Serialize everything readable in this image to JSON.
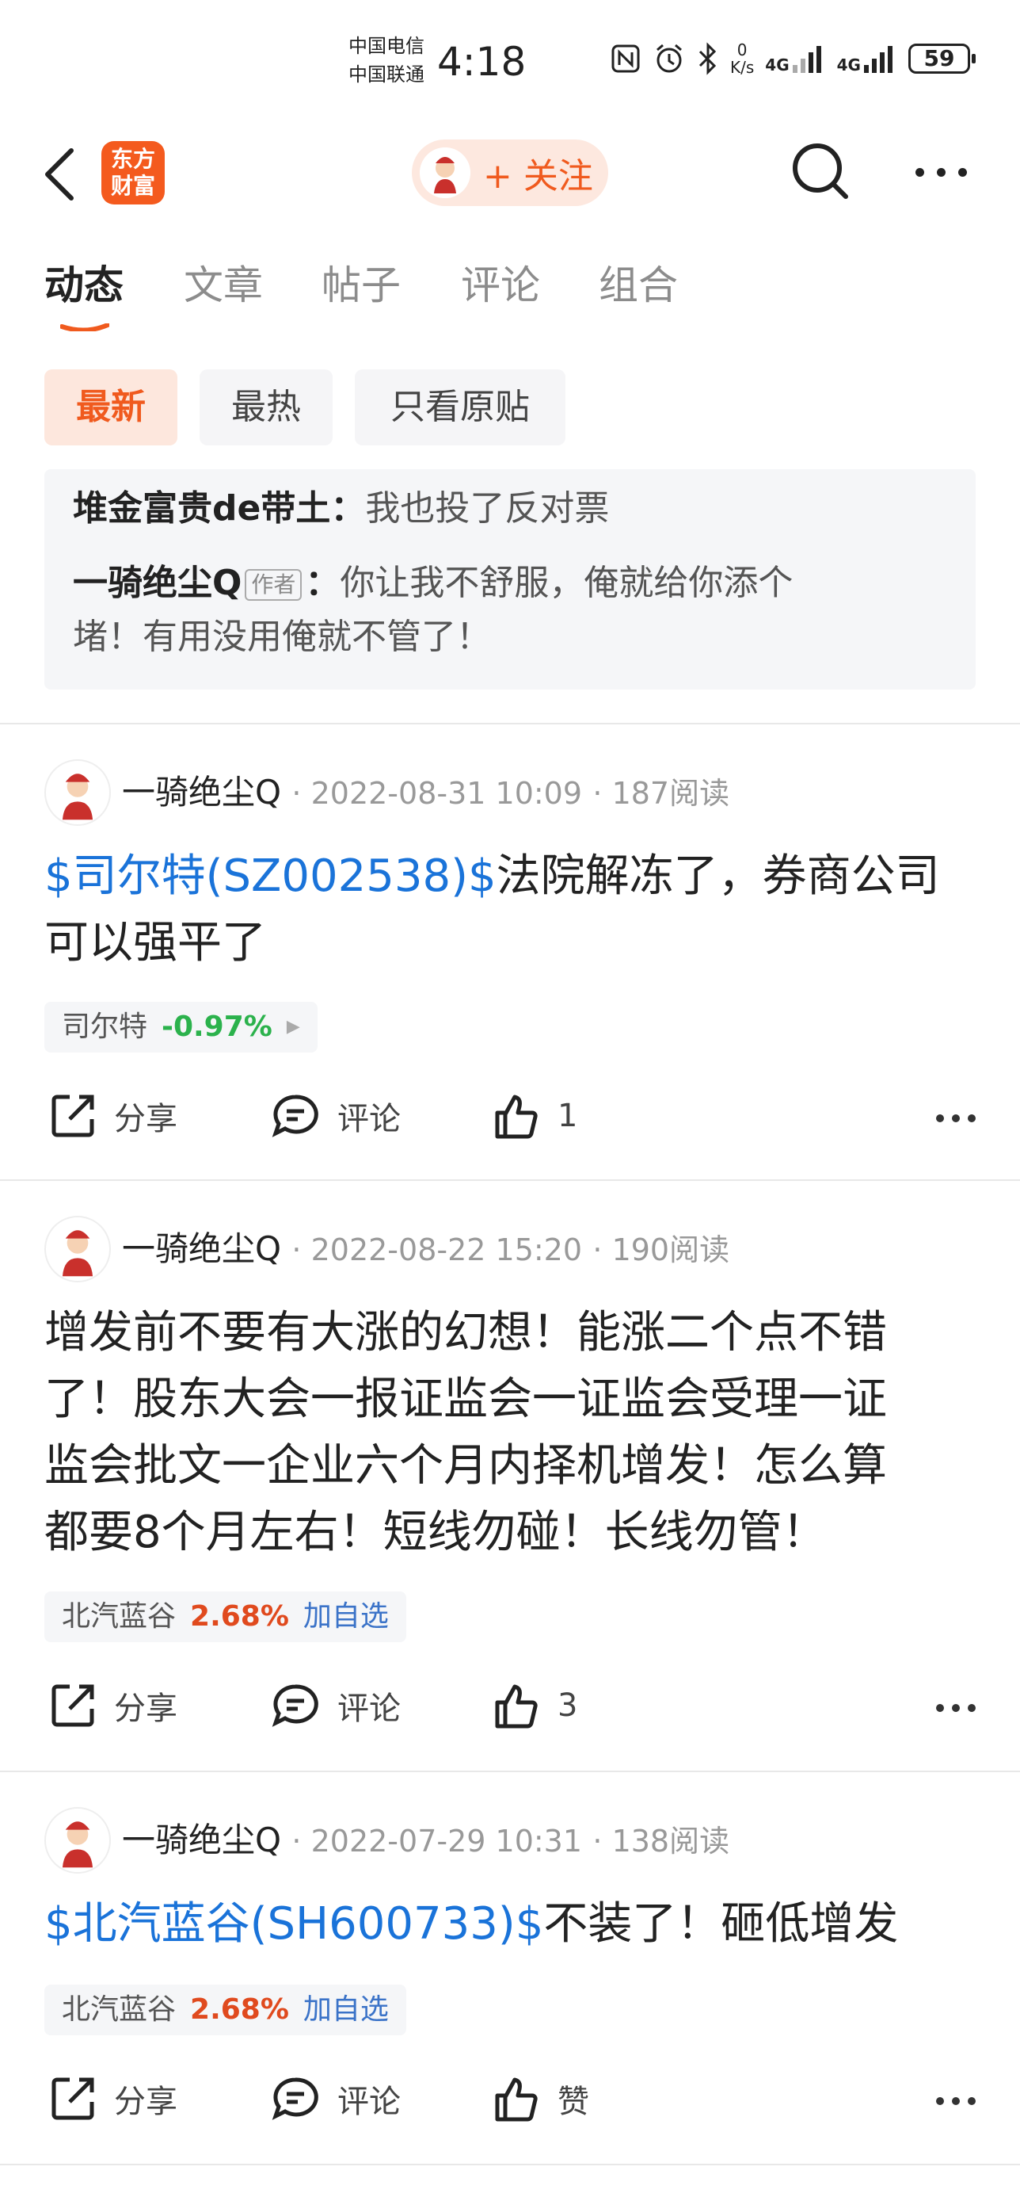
{
  "status_bar": {
    "carrier1": "中国电信",
    "carrier2": "中国联通",
    "time": "4:18",
    "net_speed_value": "0",
    "net_speed_unit": "K/s",
    "signal1": "4G",
    "signal2": "4G",
    "battery": "59"
  },
  "nav": {
    "logo_line1": "东方",
    "logo_line2": "财富",
    "follow_label": "+ 关注"
  },
  "tabs": [
    "动态",
    "文章",
    "帖子",
    "评论",
    "组合"
  ],
  "chips": [
    "最新",
    "最热",
    "只看原贴"
  ],
  "comments": [
    {
      "author": "堆金富贵de带土",
      "sep": "：",
      "text": "我也投了反对票"
    },
    {
      "author": "一骑绝尘Q",
      "tag": "作者",
      "sep": "：",
      "text1": "你让我不舒服，俺就给你添个",
      "text2": "堵！有用没用俺就不管了！"
    }
  ],
  "posts": [
    {
      "author": "一骑绝尘Q",
      "datetime": "2022-08-31 10:09",
      "reads": "187阅读",
      "link": "$司尔特(SZ002538)$",
      "line1": "法院解冻了，券商公司",
      "line2": "可以强平了",
      "stock_name": "司尔特",
      "stock_change": "-0.97%",
      "share": "分享",
      "comment": "评论",
      "like": "1"
    },
    {
      "author": "一骑绝尘Q",
      "datetime": "2022-08-22 15:20",
      "reads": "190阅读",
      "line1": "增发前不要有大涨的幻想！能涨二个点不错",
      "line2": "了！股东大会一报证监会一证监会受理一证",
      "line3": "监会批文一企业六个月内择机增发！怎么算",
      "line4": "都要8个月左右！短线勿碰！长线勿管！",
      "stock_name": "北汽蓝谷",
      "stock_change": "2.68%",
      "add_watch": "加自选",
      "share": "分享",
      "comment": "评论",
      "like": "3"
    },
    {
      "author": "一骑绝尘Q",
      "datetime": "2022-07-29 10:31",
      "reads": "138阅读",
      "link": "$北汽蓝谷(SH600733)$",
      "line1": "不装了！砸低增发",
      "stock_name": "北汽蓝谷",
      "stock_change": "2.68%",
      "add_watch": "加自选",
      "share": "分享",
      "comment": "评论",
      "like": "赞"
    }
  ],
  "colors": {
    "accent": "#f05a1e",
    "link": "#1a73d9",
    "up": "#e04a1e",
    "down": "#2bb24c"
  }
}
